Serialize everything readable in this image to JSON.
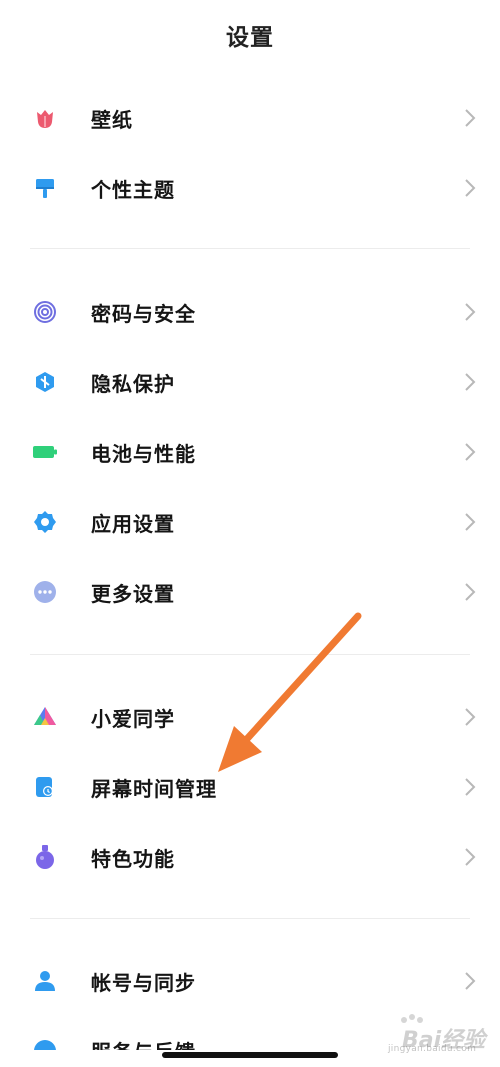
{
  "header": {
    "title": "设置"
  },
  "items": [
    {
      "label": "壁纸",
      "icon": "wallpaper-icon"
    },
    {
      "label": "个性主题",
      "icon": "theme-brush-icon"
    },
    {
      "label": "密码与安全",
      "icon": "fingerprint-icon"
    },
    {
      "label": "隐私保护",
      "icon": "privacy-shield-icon"
    },
    {
      "label": "电池与性能",
      "icon": "battery-icon"
    },
    {
      "label": "应用设置",
      "icon": "app-settings-gear-icon"
    },
    {
      "label": "更多设置",
      "icon": "more-dots-icon"
    },
    {
      "label": "小爱同学",
      "icon": "xiaoai-assistant-icon"
    },
    {
      "label": "屏幕时间管理",
      "icon": "screen-time-icon"
    },
    {
      "label": "特色功能",
      "icon": "flask-icon"
    },
    {
      "label": "帐号与同步",
      "icon": "account-user-icon"
    },
    {
      "label": "服务与反馈",
      "icon": "service-feedback-icon"
    }
  ],
  "watermark": {
    "text": "Bai经验",
    "sub": "jingyan.baidu.com"
  },
  "colors": {
    "wallpaper": "#ec5a6f",
    "theme": "#2f9bef",
    "security": "#6f6fe0",
    "privacy": "#2f9bef",
    "battery": "#2fd07a",
    "apps": "#2f9bef",
    "more": "#9fb1ea",
    "flask": "#7b66e8",
    "account": "#2f9bef",
    "arrow": "#f07a32"
  }
}
